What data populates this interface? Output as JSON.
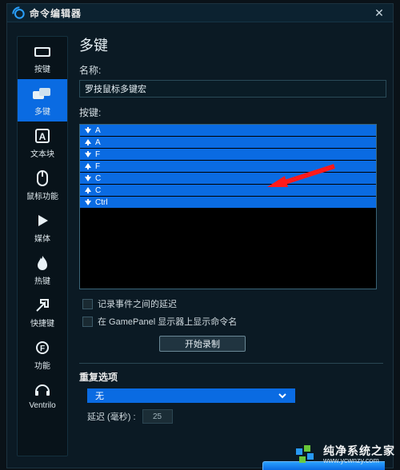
{
  "titlebar": {
    "title": "命令编辑器",
    "close": "✕"
  },
  "sidebar": {
    "items": [
      {
        "id": "keys",
        "label": "按键"
      },
      {
        "id": "multikey",
        "label": "多键",
        "active": true
      },
      {
        "id": "textblock",
        "label": "文本块"
      },
      {
        "id": "mouse",
        "label": "鼠标功能"
      },
      {
        "id": "media",
        "label": "媒体"
      },
      {
        "id": "hotkey",
        "label": "热键"
      },
      {
        "id": "shortcut",
        "label": "快捷键"
      },
      {
        "id": "functions",
        "label": "功能"
      },
      {
        "id": "ventrilo",
        "label": "Ventrilo"
      }
    ]
  },
  "main": {
    "heading": "多键",
    "name_label": "名称:",
    "name_value": "罗技鼠标多键宏",
    "keys_label": "按键:",
    "key_rows": [
      {
        "dir": "down",
        "k": "A"
      },
      {
        "dir": "up",
        "k": "A"
      },
      {
        "dir": "down",
        "k": "F"
      },
      {
        "dir": "up",
        "k": "F"
      },
      {
        "dir": "down",
        "k": "C"
      },
      {
        "dir": "up",
        "k": "C"
      },
      {
        "dir": "down",
        "k": "Ctrl"
      }
    ],
    "opt_delay": "记录事件之间的延迟",
    "opt_gamepanel": "在 GamePanel 显示器上显示命令名",
    "record_btn": "开始录制",
    "repeat_heading": "重复选项",
    "repeat_value": "无",
    "delay_label": "延迟 (毫秒) :",
    "delay_value": "25"
  },
  "watermark": {
    "name": "纯净系统之家",
    "url": "www.ycwnzy.com"
  },
  "colors": {
    "accent": "#0a6be2"
  }
}
